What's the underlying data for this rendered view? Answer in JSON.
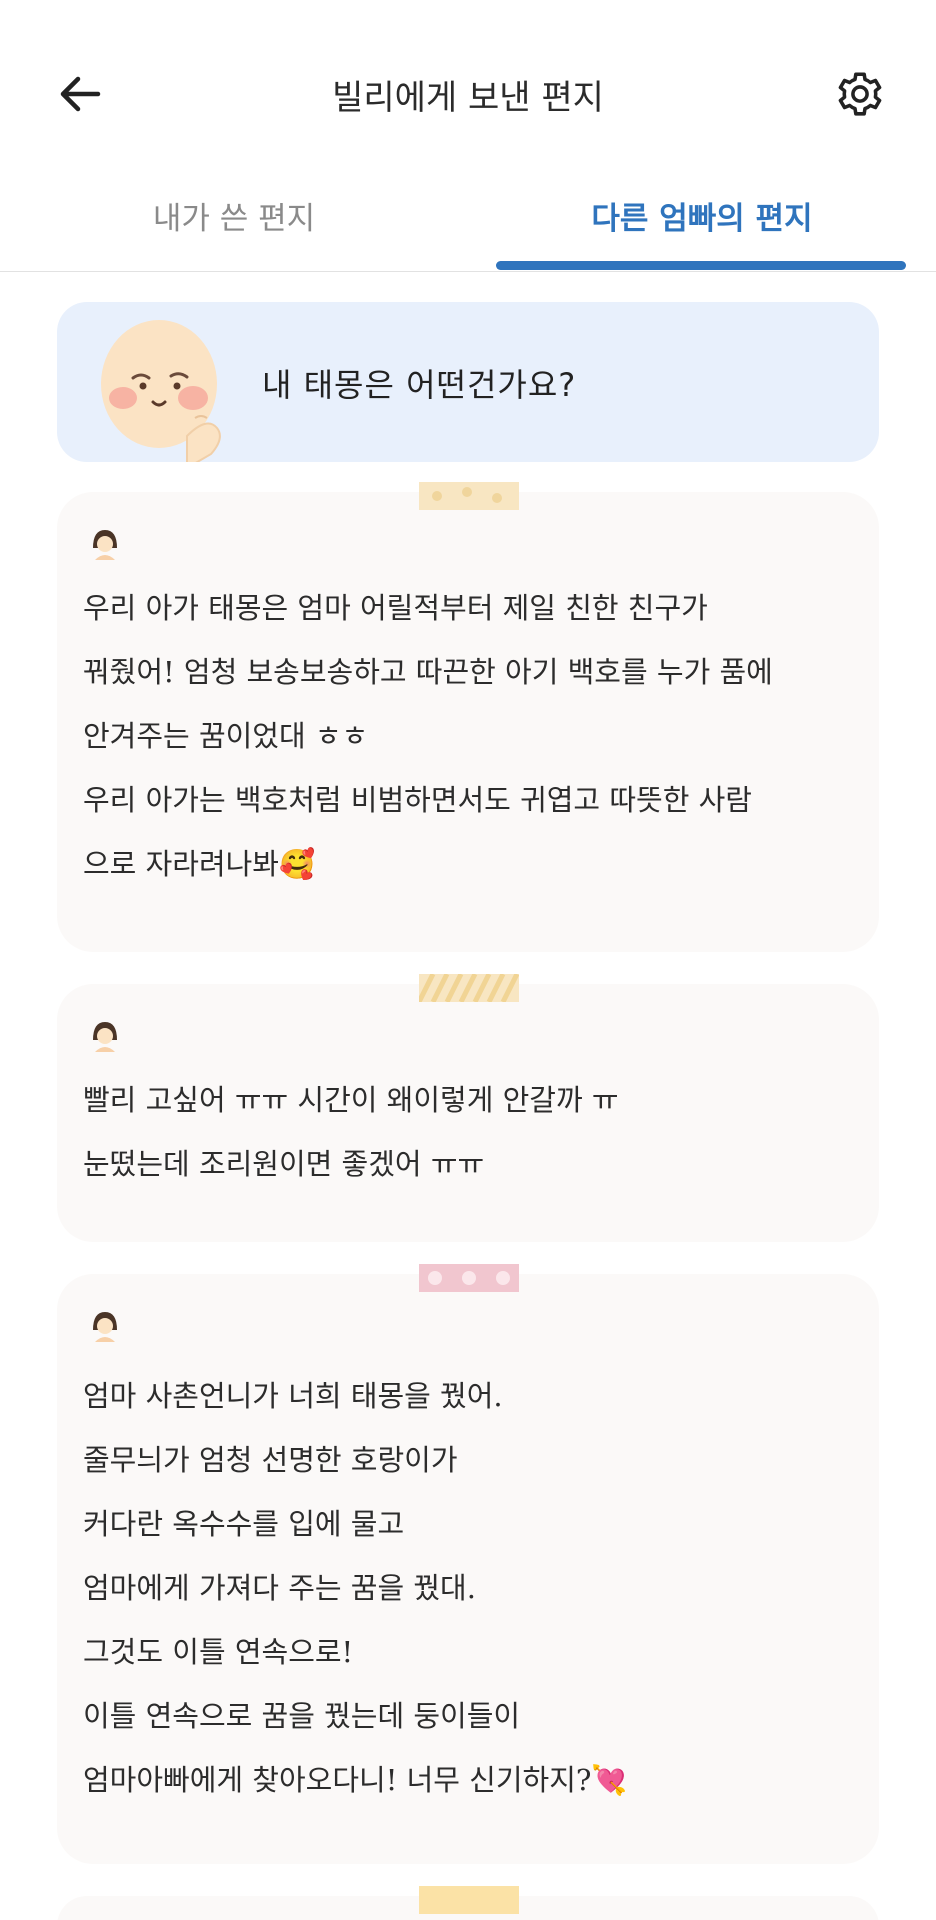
{
  "header": {
    "title": "빌리에게 보낸 편지"
  },
  "tabs": [
    {
      "label": "내가 쓴 편지",
      "active": false
    },
    {
      "label": "다른 엄빠의 편지",
      "active": true
    }
  ],
  "colors": {
    "accent": "#2f74bd",
    "banner_bg": "#e8f0fc",
    "card_bg": "#fbf9f8"
  },
  "banner": {
    "question": "내 태몽은 어떤건가요?"
  },
  "letters": [
    {
      "text": "우리 아가 태몽은 엄마 어릴적부터 제일 친한 친구가\n꿔줬어! 엄청 보송보송하고 따끈한 아기 백호를 누가 품에\n안겨주는 꿈이었대 ㅎㅎ\n우리 아가는 백호처럼 비범하면서도 귀엽고 따뜻한 사람\n으로 자라려나봐🥰"
    },
    {
      "text": "빨리 고싶어 ㅠㅠ 시간이 왜이렇게 안갈까 ㅠ\n눈떴는데 조리원이면 좋겠어 ㅠㅠ"
    },
    {
      "text": "엄마 사촌언니가 너희 태몽을 꿨어.\n줄무늬가 엄청 선명한 호랑이가\n커다란 옥수수를 입에 물고\n엄마에게 가져다 주는 꿈을 꿨대.\n그것도 이틀 연속으로!\n이틀 연속으로 꿈을 꿨는데 둥이들이\n엄마아빠에게 찾아오다니! 너무 신기하지?💘"
    }
  ],
  "icons": {
    "back": "arrow-left-icon",
    "settings": "gear-icon",
    "author": "girl-avatar-icon"
  }
}
